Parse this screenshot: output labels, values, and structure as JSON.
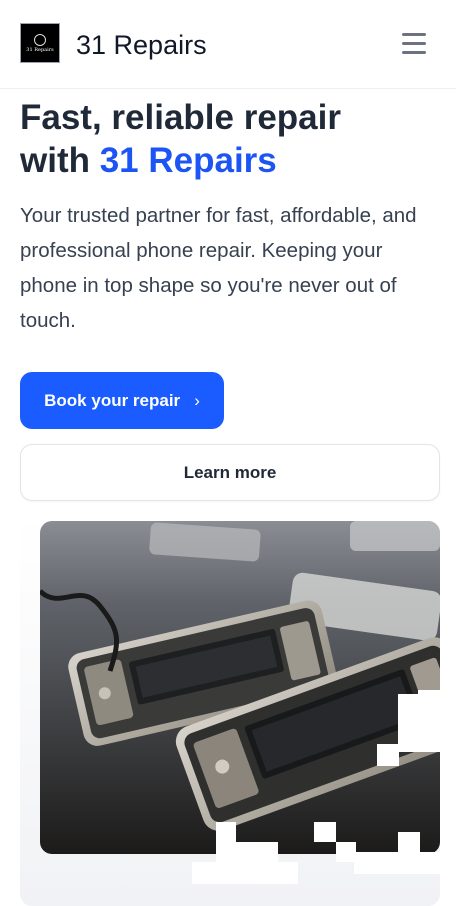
{
  "header": {
    "logo_text": "31 Repairs",
    "brand": "31 Repairs"
  },
  "hero": {
    "headline_line1": "Fast, reliable repair",
    "headline_with": "with ",
    "headline_accent": "31 Repairs",
    "subtitle": "Your trusted partner for fast, affordable, and professional phone repair. Keeping your phone in top shape so you're never out of touch.",
    "primary_button": "Book your repair",
    "primary_button_icon": "chevron-right-icon",
    "secondary_button": "Learn more",
    "image_subject": "disassembled-phones"
  },
  "colors": {
    "accent": "#1a5cff",
    "accent_text": "#1d55f5",
    "heading": "#1f2937"
  }
}
